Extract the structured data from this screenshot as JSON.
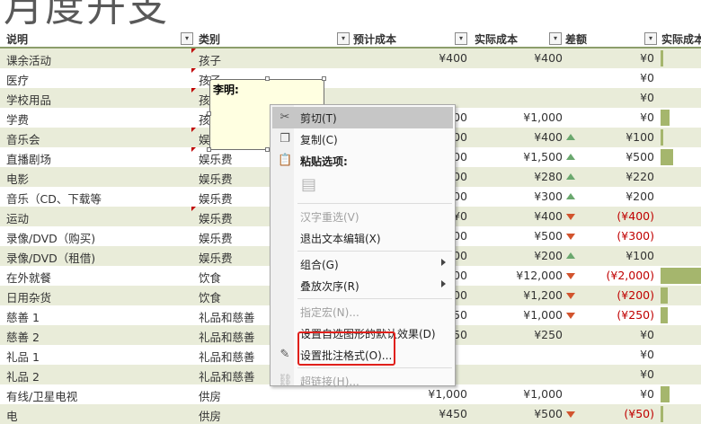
{
  "page": {
    "title": "月度开支"
  },
  "columns": [
    {
      "label": "说明",
      "filter": true
    },
    {
      "label": "类别",
      "filter": true
    },
    {
      "label": "预计成本",
      "filter": true
    },
    {
      "label": "实际成本",
      "filter": true
    },
    {
      "label": "差额",
      "filter": true
    },
    {
      "label": "实际成本",
      "filter": true
    }
  ],
  "icons": {
    "filter": "filter-dropdown-icon",
    "up": "triangle-up-icon",
    "down": "triangle-down-icon"
  },
  "colors": {
    "row_band": "#e9ecd9",
    "data_bar": "#a5b66d",
    "up": "#6aa86e",
    "down": "#d2542e",
    "negative": "#c00000",
    "highlight_box": "#e0201b"
  },
  "rows": [
    {
      "desc": "课余活动",
      "cat": "孩子",
      "plan": "¥400",
      "actual": "¥400",
      "diff": "¥0",
      "trend": "",
      "bar": 0.06,
      "neg": false,
      "comment": true
    },
    {
      "desc": "医疗",
      "cat": "孩子",
      "plan": "",
      "actual": "",
      "diff": "¥0",
      "trend": "",
      "bar": 0,
      "neg": false,
      "comment": true
    },
    {
      "desc": "学校用品",
      "cat": "孩",
      "plan": "",
      "actual": "",
      "diff": "¥0",
      "trend": "",
      "bar": 0,
      "neg": false,
      "comment": true
    },
    {
      "desc": "学费",
      "cat": "孩",
      "plan": "00",
      "actual": "¥1,000",
      "diff": "¥0",
      "trend": "",
      "bar": 0.22,
      "neg": false,
      "comment": false
    },
    {
      "desc": "音乐会",
      "cat": "娱",
      "plan": "00",
      "actual": "¥400",
      "diff": "¥100",
      "trend": "up",
      "bar": 0.06,
      "neg": false,
      "comment": true
    },
    {
      "desc": "直播剧场",
      "cat": "娱乐费",
      "plan": "00",
      "actual": "¥1,500",
      "diff": "¥500",
      "trend": "up",
      "bar": 0.32,
      "neg": false,
      "comment": true
    },
    {
      "desc": "电影",
      "cat": "娱乐费",
      "plan": "00",
      "actual": "¥280",
      "diff": "¥220",
      "trend": "up",
      "bar": 0,
      "neg": false,
      "comment": false
    },
    {
      "desc": "音乐（CD、下载等",
      "cat": "娱乐费",
      "plan": "00",
      "actual": "¥300",
      "diff": "¥200",
      "trend": "up",
      "bar": 0,
      "neg": false,
      "comment": false
    },
    {
      "desc": "运动",
      "cat": "娱乐费",
      "plan": "¥0",
      "actual": "¥400",
      "diff": "(¥400)",
      "trend": "down",
      "bar": 0,
      "neg": true,
      "comment": true
    },
    {
      "desc": "录像/DVD（购买)",
      "cat": "娱乐费",
      "plan": "00",
      "actual": "¥500",
      "diff": "(¥300)",
      "trend": "down",
      "bar": 0,
      "neg": true,
      "comment": false
    },
    {
      "desc": "录像/DVD（租借)",
      "cat": "娱乐费",
      "plan": "00",
      "actual": "¥200",
      "diff": "¥100",
      "trend": "up",
      "bar": 0,
      "neg": false,
      "comment": false
    },
    {
      "desc": "在外就餐",
      "cat": "饮食",
      "plan": "00",
      "actual": "¥12,000",
      "diff": "(¥2,000)",
      "trend": "down",
      "bar": 1.0,
      "neg": true,
      "comment": false
    },
    {
      "desc": "日用杂货",
      "cat": "饮食",
      "plan": "00",
      "actual": "¥1,200",
      "diff": "(¥200)",
      "trend": "down",
      "bar": 0.18,
      "neg": true,
      "comment": false
    },
    {
      "desc": "慈善 1",
      "cat": "礼品和慈善",
      "plan": "50",
      "actual": "¥1,000",
      "diff": "(¥250)",
      "trend": "down",
      "bar": 0.18,
      "neg": true,
      "comment": false
    },
    {
      "desc": "慈善 2",
      "cat": "礼品和慈善",
      "plan": "50",
      "actual": "¥250",
      "diff": "¥0",
      "trend": "",
      "bar": 0,
      "neg": false,
      "comment": false
    },
    {
      "desc": "礼品 1",
      "cat": "礼品和慈善",
      "plan": "",
      "actual": "",
      "diff": "¥0",
      "trend": "",
      "bar": 0,
      "neg": false,
      "comment": false
    },
    {
      "desc": "礼品 2",
      "cat": "礼品和慈善",
      "plan": "",
      "actual": "",
      "diff": "¥0",
      "trend": "",
      "bar": 0,
      "neg": false,
      "comment": false
    },
    {
      "desc": "有线/卫星电视",
      "cat": "供房",
      "plan": "¥1,000",
      "actual": "¥1,000",
      "diff": "¥0",
      "trend": "",
      "bar": 0.22,
      "neg": false,
      "comment": false
    },
    {
      "desc": "电",
      "cat": "供房",
      "plan": "¥450",
      "actual": "¥500",
      "diff": "(¥50)",
      "trend": "down",
      "bar": 0.06,
      "neg": true,
      "comment": false
    }
  ],
  "comment": {
    "author": "李明:"
  },
  "context_menu": {
    "items": [
      {
        "type": "item",
        "label": "剪切(T)",
        "icon": "scissors-icon",
        "glyph": "✂",
        "highlighted": true,
        "disabled": false,
        "submenu": false
      },
      {
        "type": "item",
        "label": "复制(C)",
        "icon": "copy-icon",
        "glyph": "❐",
        "highlighted": false,
        "disabled": false,
        "submenu": false
      },
      {
        "type": "header",
        "label": "粘贴选项:",
        "icon": "clipboard-icon",
        "glyph": "📋",
        "highlighted": false,
        "disabled": false,
        "submenu": false
      },
      {
        "type": "paste",
        "label": "",
        "icon": "paste-option-icon",
        "glyph": "▤",
        "highlighted": false,
        "disabled": true,
        "submenu": false
      },
      {
        "type": "sep"
      },
      {
        "type": "item",
        "label": "汉字重选(V)",
        "icon": "",
        "glyph": "",
        "highlighted": false,
        "disabled": true,
        "submenu": false
      },
      {
        "type": "item",
        "label": "退出文本编辑(X)",
        "icon": "",
        "glyph": "",
        "highlighted": false,
        "disabled": false,
        "submenu": false
      },
      {
        "type": "sep"
      },
      {
        "type": "item",
        "label": "组合(G)",
        "icon": "",
        "glyph": "",
        "highlighted": false,
        "disabled": false,
        "submenu": true
      },
      {
        "type": "item",
        "label": "叠放次序(R)",
        "icon": "",
        "glyph": "",
        "highlighted": false,
        "disabled": false,
        "submenu": true
      },
      {
        "type": "sep"
      },
      {
        "type": "item",
        "label": "指定宏(N)...",
        "icon": "",
        "glyph": "",
        "highlighted": false,
        "disabled": true,
        "submenu": false
      },
      {
        "type": "item",
        "label": "设置自选图形的默认效果(D)",
        "icon": "",
        "glyph": "",
        "highlighted": false,
        "disabled": false,
        "submenu": false
      },
      {
        "type": "item",
        "label": "设置批注格式(O)...",
        "icon": "format-comment-icon",
        "glyph": "✎",
        "highlighted": false,
        "disabled": false,
        "submenu": false
      },
      {
        "type": "sep"
      },
      {
        "type": "item",
        "label": "超链接(H)...",
        "icon": "hyperlink-icon",
        "glyph": "⛓",
        "highlighted": false,
        "disabled": true,
        "submenu": false
      }
    ]
  }
}
